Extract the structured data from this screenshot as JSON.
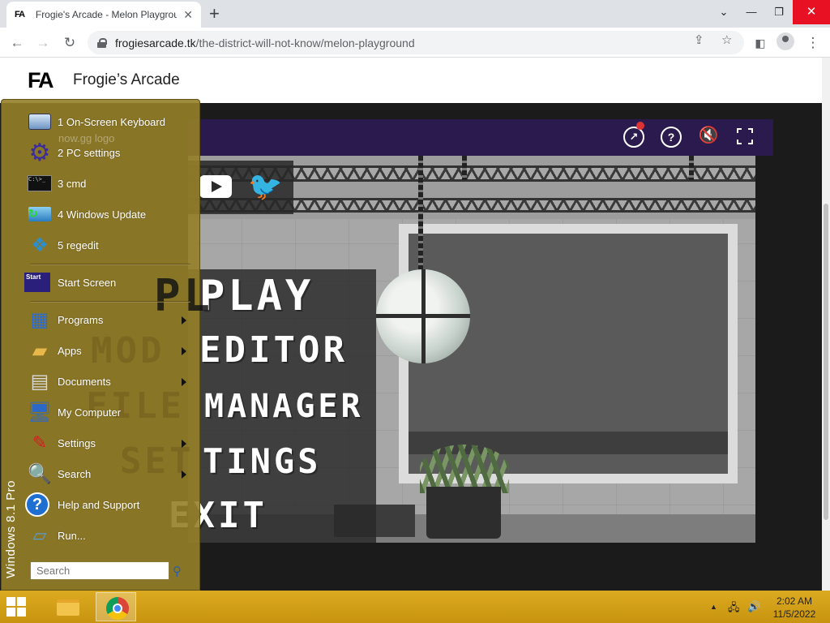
{
  "browser": {
    "tab_favicon": "FA",
    "tab_title": "Frogie's Arcade - Melon Playground",
    "tab_close": "✕",
    "new_tab": "+",
    "url_host": "frogiesarcade.tk",
    "url_path": "/the-district-will-not-know/melon-playground",
    "icons": [
      "back-icon",
      "forward-icon",
      "reload-icon",
      "lock-icon",
      "share-icon",
      "star-icon",
      "sidepanel-icon",
      "profile-icon",
      "menu-icon"
    ],
    "window_buttons": {
      "dropdown": "⌄",
      "minimize": "—",
      "restore": "❐",
      "close": "✕"
    }
  },
  "site": {
    "logo": "FA",
    "name": "Frogie’s Arcade"
  },
  "game": {
    "topbar_icons": [
      "chart-icon",
      "help-icon",
      "mute-icon",
      "fullscreen-icon"
    ],
    "menu": {
      "play": "PLAY",
      "editor": "EDITOR",
      "manager": "MANAGER",
      "settings": "TINGS",
      "exit": "EXIT",
      "mod_partial": "MOD",
      "file_partial": "FILE",
      "set_partial": "SET",
      "pl_partial": "PL"
    },
    "ghost_text": "now.gg logo"
  },
  "start_menu": {
    "brand": "Windows 8.1 Pro",
    "items": [
      {
        "label": "1 On-Screen Keyboard",
        "icon": "keyboard-icon"
      },
      {
        "label": "2 PC settings",
        "icon": "gear-icon"
      },
      {
        "label": "3 cmd",
        "icon": "cmd-icon"
      },
      {
        "label": "4 Windows Update",
        "icon": "windows-update-icon"
      },
      {
        "label": "5 regedit",
        "icon": "regedit-icon"
      },
      {
        "label": "Start Screen",
        "icon": "start-screen-icon"
      },
      {
        "label": "Programs",
        "icon": "programs-icon"
      },
      {
        "label": "Apps",
        "icon": "apps-icon"
      },
      {
        "label": "Documents",
        "icon": "documents-icon"
      },
      {
        "label": "My Computer",
        "icon": "computer-icon"
      },
      {
        "label": "Settings",
        "icon": "settings-icon"
      },
      {
        "label": "Search",
        "icon": "search-icon"
      },
      {
        "label": "Help and Support",
        "icon": "help-icon"
      },
      {
        "label": "Run...",
        "icon": "run-icon"
      }
    ],
    "start_icon_text": "Start",
    "cmd_icon_text": "C:\\>_",
    "search_placeholder": "Search"
  },
  "taskbar": {
    "time": "2:02 AM",
    "date": "11/5/2022",
    "accent": "#d2a016"
  }
}
